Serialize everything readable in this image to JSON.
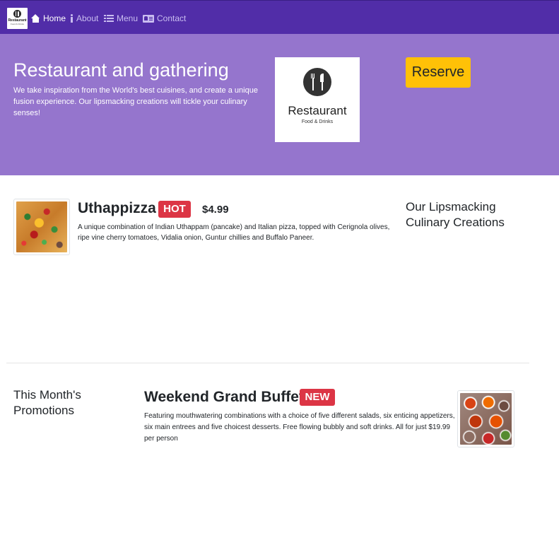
{
  "navbar": {
    "brand": {
      "name": "Restaurant",
      "subtitle": "Food & Drinks",
      "icon": "fork-knife-plate-icon"
    },
    "items": [
      {
        "label": "Home",
        "icon": "home-icon",
        "active": true
      },
      {
        "label": "About",
        "icon": "info-icon",
        "active": false
      },
      {
        "label": "Menu",
        "icon": "list-icon",
        "active": false
      },
      {
        "label": "Contact",
        "icon": "address-card-icon",
        "active": false
      }
    ]
  },
  "hero": {
    "title": "Restaurant and gathering",
    "text": "We take inspiration from the World's best cuisines, and create a unique fusion experience. Our lipsmacking creations will tickle your culinary senses!",
    "logo": {
      "name": "Restaurant",
      "subtitle": "Food & Drinks"
    },
    "reserve_label": "Reserve"
  },
  "dish": {
    "name": "Uthappizza",
    "badge": "HOT",
    "price": "$4.99",
    "description": "A unique combination of Indian Uthappam (pancake) and Italian pizza, topped with Cerignola olives, ripe vine cherry tomatoes, Vidalia onion, Guntur chillies and Buffalo Paneer."
  },
  "creations": {
    "heading": "Our Lipsmacking Culinary Creations"
  },
  "promotions": {
    "heading": "This Month's Promotions",
    "title": "Weekend Grand Buffet",
    "badge": "NEW",
    "description": "Featuring mouthwatering combinations with a choice of five different salads, six enticing appetizers, six main entrees and five choicest desserts. Free flowing bubbly and soft drinks. All for just $19.99 per person"
  },
  "colors": {
    "navbar": "#512da8",
    "hero": "#9575cd",
    "reserve": "#ffc107",
    "badge": "#dc3545",
    "nav_inactive": "#c9bdf0"
  }
}
